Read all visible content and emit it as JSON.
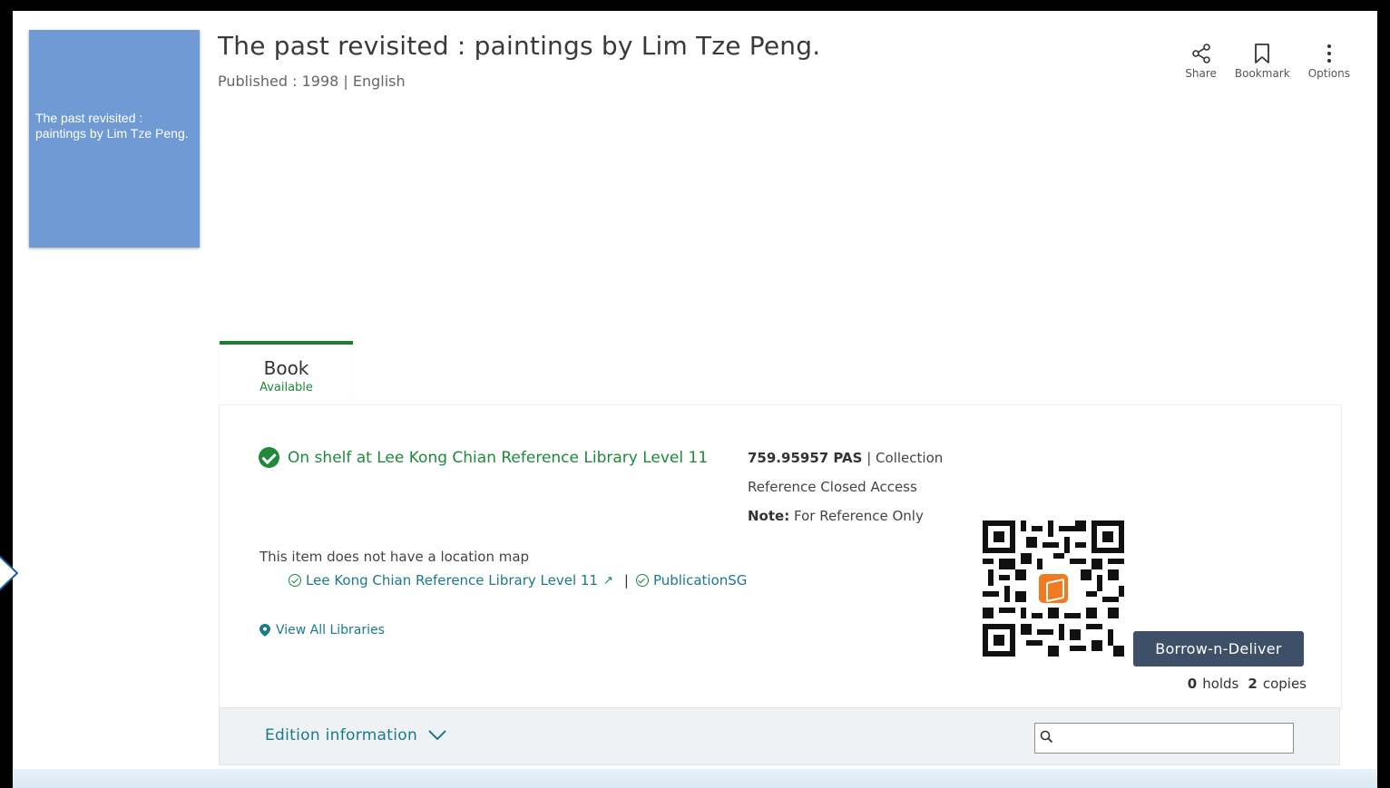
{
  "record": {
    "cover_text": "The past revisited : paintings by Lim Tze Peng.",
    "title": "The past revisited : paintings by Lim Tze Peng.",
    "published": "Published : 1998 | English"
  },
  "actions": [
    {
      "label": "Share",
      "icon": "share-icon"
    },
    {
      "label": "Bookmark",
      "icon": "bookmark-icon"
    },
    {
      "label": "Options",
      "icon": "more-vertical-icon"
    }
  ],
  "tab": {
    "title": "Book",
    "status": "Available"
  },
  "availability": {
    "shelf": "On shelf at Lee Kong Chian Reference Library Level 11",
    "call_number": "759.95957 PAS",
    "collection_label": "| Collection",
    "access": "Reference Closed Access",
    "note_label": "Note:",
    "note_text": "For Reference Only",
    "no_map": "This item does not have a location map",
    "location_link": "Lee Kong Chian Reference Library Level 11",
    "publication_link": "PublicationSG",
    "view_all": "View All Libraries"
  },
  "borrow": {
    "button_label": "Borrow-n-Deliver",
    "holds_count": "0",
    "holds_label": "holds",
    "copies_count": "2",
    "copies_label": "copies"
  },
  "edition": {
    "label": "Edition information",
    "search_placeholder": ""
  },
  "colors": {
    "accent_green": "#1e8a3a",
    "link_teal": "#1b7a8a",
    "button_dark": "#3d5068",
    "cover_blue": "#6f9ad3"
  }
}
